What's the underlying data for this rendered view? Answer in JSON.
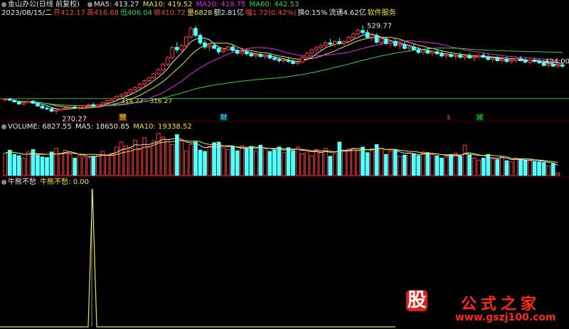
{
  "header": {
    "stock_name": "金山办公(日线 前复权)",
    "ma5": "MA5: 413.27",
    "ma10": "MA10: 419.52",
    "ma20": "MA20: 419.75",
    "ma60": "MA60: 442.53",
    "date": "2023/08/15/二",
    "open": "开412.17",
    "high": "高416.68",
    "low": "低406.04",
    "close": "收410.72",
    "volume": "量6828",
    "amount": "额2.81亿",
    "change": "幅1.72(0.42%)",
    "turnover": "换0.15%",
    "float_cap": "流通4.62亿",
    "sector": "软件服务"
  },
  "volume_header": {
    "volume": "VOLUME: 6827.55",
    "ma5": "MA5: 18650.85",
    "ma10": "MA10: 19338.52"
  },
  "indicator_header": {
    "name": "牛熊不愁",
    "value": "牛熊不愁: 0.00"
  },
  "chart_data": [
    {
      "type": "candlestick",
      "annotations": [
        "529.77",
        "270.27",
        "424.00",
        "314.77 - 316.27"
      ],
      "markers": [
        "预",
        "财",
        "$",
        "减"
      ],
      "price_range": [
        255,
        545
      ],
      "candles": [
        [
          312,
          316,
          306,
          314
        ],
        [
          314,
          318,
          309,
          311
        ],
        [
          311,
          313,
          304,
          306
        ],
        [
          306,
          309,
          298,
          300
        ],
        [
          300,
          306,
          296,
          304
        ],
        [
          304,
          310,
          301,
          308
        ],
        [
          308,
          311,
          300,
          302
        ],
        [
          302,
          305,
          292,
          294
        ],
        [
          294,
          298,
          285,
          288
        ],
        [
          288,
          293,
          282,
          286
        ],
        [
          286,
          290,
          276,
          279
        ],
        [
          279,
          284,
          270,
          282
        ],
        [
          282,
          288,
          279,
          286
        ],
        [
          286,
          292,
          283,
          289
        ],
        [
          289,
          294,
          285,
          291
        ],
        [
          291,
          296,
          286,
          288
        ],
        [
          288,
          293,
          282,
          290
        ],
        [
          290,
          297,
          287,
          295
        ],
        [
          295,
          301,
          292,
          298
        ],
        [
          298,
          303,
          292,
          294
        ],
        [
          294,
          300,
          291,
          298
        ],
        [
          298,
          306,
          296,
          304
        ],
        [
          304,
          312,
          302,
          310
        ],
        [
          310,
          318,
          307,
          315
        ],
        [
          315,
          325,
          312,
          322
        ],
        [
          322,
          330,
          318,
          326
        ],
        [
          326,
          336,
          322,
          333
        ],
        [
          333,
          345,
          330,
          341
        ],
        [
          341,
          352,
          337,
          348
        ],
        [
          348,
          362,
          344,
          358
        ],
        [
          358,
          372,
          352,
          368
        ],
        [
          368,
          380,
          362,
          376
        ],
        [
          376,
          392,
          372,
          388
        ],
        [
          388,
          405,
          384,
          400
        ],
        [
          400,
          420,
          395,
          416
        ],
        [
          416,
          440,
          410,
          435
        ],
        [
          435,
          470,
          430,
          465
        ],
        [
          465,
          480,
          450,
          458
        ],
        [
          458,
          475,
          445,
          470
        ],
        [
          470,
          500,
          465,
          495
        ],
        [
          495,
          525,
          490,
          520
        ],
        [
          520,
          528,
          495,
          500
        ],
        [
          500,
          505,
          472,
          478
        ],
        [
          478,
          486,
          460,
          466
        ],
        [
          466,
          474,
          455,
          470
        ],
        [
          470,
          478,
          460,
          462
        ],
        [
          462,
          468,
          445,
          452
        ],
        [
          452,
          462,
          448,
          458
        ],
        [
          458,
          470,
          455,
          466
        ],
        [
          466,
          472,
          452,
          456
        ],
        [
          456,
          462,
          444,
          448
        ],
        [
          448,
          456,
          440,
          452
        ],
        [
          452,
          458,
          442,
          446
        ],
        [
          446,
          452,
          436,
          440
        ],
        [
          440,
          448,
          432,
          444
        ],
        [
          444,
          450,
          436,
          438
        ],
        [
          438,
          446,
          430,
          442
        ],
        [
          442,
          448,
          430,
          434
        ],
        [
          434,
          440,
          425,
          430
        ],
        [
          430,
          436,
          420,
          426
        ],
        [
          426,
          432,
          418,
          428
        ],
        [
          428,
          434,
          420,
          424
        ],
        [
          424,
          430,
          414,
          418
        ],
        [
          418,
          426,
          412,
          422
        ],
        [
          422,
          440,
          418,
          436
        ],
        [
          436,
          452,
          432,
          448
        ],
        [
          448,
          462,
          444,
          458
        ],
        [
          458,
          470,
          450,
          464
        ],
        [
          464,
          476,
          458,
          470
        ],
        [
          470,
          484,
          462,
          478
        ],
        [
          478,
          490,
          468,
          474
        ],
        [
          474,
          486,
          466,
          482
        ],
        [
          482,
          492,
          472,
          476
        ],
        [
          476,
          486,
          466,
          482
        ],
        [
          482,
          498,
          476,
          494
        ],
        [
          494,
          510,
          488,
          504
        ],
        [
          504,
          520,
          498,
          514
        ],
        [
          514,
          529,
          504,
          508
        ],
        [
          508,
          516,
          490,
          494
        ],
        [
          494,
          506,
          484,
          500
        ],
        [
          500,
          506,
          476,
          480
        ],
        [
          480,
          494,
          470,
          490
        ],
        [
          490,
          496,
          472,
          476
        ],
        [
          476,
          486,
          464,
          482
        ],
        [
          482,
          490,
          466,
          470
        ],
        [
          470,
          480,
          460,
          474
        ],
        [
          474,
          482,
          458,
          462
        ],
        [
          462,
          470,
          452,
          466
        ],
        [
          466,
          474,
          456,
          458
        ],
        [
          458,
          466,
          446,
          450
        ],
        [
          450,
          460,
          444,
          456
        ],
        [
          456,
          464,
          446,
          448
        ],
        [
          448,
          456,
          440,
          452
        ],
        [
          452,
          460,
          444,
          446
        ],
        [
          446,
          454,
          436,
          440
        ],
        [
          440,
          448,
          432,
          444
        ],
        [
          444,
          452,
          436,
          438
        ],
        [
          438,
          446,
          430,
          442
        ],
        [
          442,
          450,
          432,
          436
        ],
        [
          436,
          444,
          428,
          440
        ],
        [
          440,
          448,
          432,
          434
        ],
        [
          434,
          442,
          424,
          438
        ],
        [
          438,
          446,
          430,
          442
        ],
        [
          442,
          450,
          434,
          436
        ],
        [
          436,
          444,
          426,
          430
        ],
        [
          430,
          438,
          420,
          434
        ],
        [
          434,
          440,
          424,
          426
        ],
        [
          426,
          434,
          418,
          430
        ],
        [
          430,
          438,
          420,
          424
        ],
        [
          424,
          432,
          416,
          428
        ],
        [
          428,
          436,
          420,
          432
        ],
        [
          432,
          440,
          424,
          426
        ],
        [
          426,
          434,
          418,
          422
        ],
        [
          422,
          430,
          414,
          428
        ],
        [
          428,
          436,
          420,
          424
        ],
        [
          424,
          432,
          416,
          420
        ],
        [
          420,
          428,
          410,
          412
        ],
        [
          412,
          420,
          406,
          416
        ],
        [
          416,
          424,
          408,
          410
        ],
        [
          410,
          418,
          404,
          414
        ],
        [
          414,
          420,
          406,
          410
        ]
      ]
    },
    {
      "type": "bar",
      "series_name": "VOLUME",
      "volume_range": [
        0,
        35000
      ],
      "values": [
        18000,
        20500,
        17000,
        16000,
        14000,
        19000,
        21000,
        16500,
        15000,
        14500,
        19000,
        22000,
        18000,
        20500,
        17000,
        14000,
        16000,
        15000,
        14500,
        15500,
        17000,
        19500,
        16000,
        18000,
        23000,
        27000,
        24000,
        22000,
        28500,
        21000,
        30500,
        23000,
        28000,
        34000,
        31000,
        29000,
        25000,
        33000,
        28000,
        20000,
        25000,
        27000,
        20500,
        19500,
        23500,
        26500,
        27000,
        22500,
        21000,
        23000,
        20000,
        24000,
        22000,
        23500,
        20000,
        24500,
        21500,
        19500,
        20500,
        23000,
        18500,
        22500,
        20000,
        23000,
        17500,
        19500,
        16000,
        21000,
        19000,
        22000,
        15500,
        18000,
        27000,
        19500,
        21500,
        22000,
        20000,
        23000,
        18500,
        21500,
        25000,
        22000,
        17000,
        20000,
        21000,
        15500,
        16500,
        18000,
        17500,
        16000,
        19000,
        18500,
        17000,
        16000,
        14000,
        15000,
        17000,
        18000,
        15500,
        24500,
        16500,
        14000,
        12500,
        14000,
        17000,
        13500,
        13000,
        15000,
        12000,
        11000,
        14000,
        13000,
        12500,
        12000,
        11500,
        11000,
        10500,
        8000,
        9500,
        2000
      ],
      "rising": [
        1,
        0,
        0,
        0,
        1,
        1,
        0,
        0,
        0,
        0,
        0,
        1,
        1,
        1,
        1,
        0,
        1,
        1,
        1,
        0,
        1,
        1,
        1,
        1,
        1,
        1,
        1,
        1,
        1,
        1,
        1,
        1,
        1,
        1,
        1,
        1,
        1,
        0,
        1,
        1,
        1,
        0,
        0,
        0,
        1,
        0,
        0,
        1,
        1,
        0,
        0,
        1,
        0,
        0,
        1,
        0,
        1,
        0,
        0,
        0,
        1,
        0,
        0,
        1,
        1,
        1,
        1,
        1,
        1,
        1,
        0,
        1,
        0,
        1,
        1,
        1,
        1,
        0,
        0,
        1,
        0,
        1,
        0,
        1,
        0,
        1,
        0,
        1,
        0,
        0,
        1,
        0,
        1,
        0,
        0,
        1,
        0,
        1,
        0,
        1,
        0,
        1,
        1,
        0,
        0,
        1,
        0,
        1,
        0,
        1,
        1,
        0,
        0,
        1,
        0,
        0,
        0,
        1,
        0,
        1,
        0
      ]
    },
    {
      "type": "line",
      "series_name": "牛熊不愁",
      "ylim": [
        0,
        1
      ],
      "values_note_x": [
        130
      ],
      "values": [
        0,
        0,
        0,
        0,
        0,
        0,
        0,
        0,
        0,
        0,
        0,
        0,
        0,
        0,
        0,
        0,
        0,
        0,
        0,
        0,
        0,
        0,
        0,
        0,
        0,
        0,
        0,
        0,
        0,
        0,
        0,
        0,
        1,
        0,
        0,
        0,
        0,
        0,
        0,
        0,
        0,
        0,
        0,
        0,
        0,
        0,
        0,
        0,
        0,
        0,
        0,
        0,
        0,
        0,
        0,
        0,
        0,
        0,
        0,
        0,
        0,
        0,
        0,
        0,
        0,
        0,
        0,
        0,
        0,
        0,
        0,
        0,
        0,
        0,
        0,
        0,
        0,
        0,
        0,
        0,
        0,
        0,
        0,
        0,
        0,
        0,
        0,
        0,
        0,
        0,
        0,
        0,
        0,
        0,
        0,
        0,
        0,
        0,
        0,
        0,
        0,
        0,
        0,
        0,
        0,
        0,
        0,
        0,
        0,
        0,
        0,
        0,
        0,
        0,
        0,
        0,
        0,
        0,
        0,
        0,
        0
      ]
    }
  ],
  "watermark": {
    "logo_char": "股",
    "name": "公式之家",
    "url": "www.gszj100.com"
  }
}
